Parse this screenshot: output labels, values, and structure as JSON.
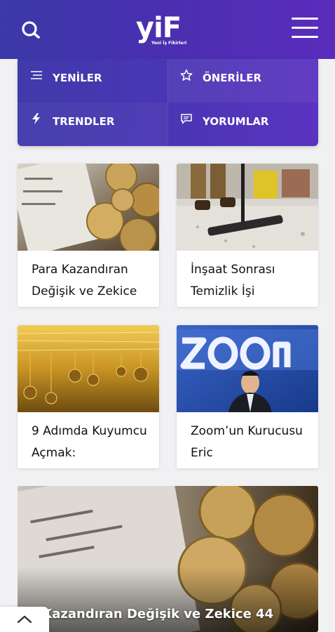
{
  "header": {
    "logo_text": "yiF",
    "logo_tagline": "Yeni İş Fikirleri",
    "search_icon": "search-icon",
    "menu_icon": "hamburger-menu-icon"
  },
  "categories": [
    {
      "label": "YENİLER",
      "icon": "list-icon"
    },
    {
      "label": "ÖNERİLER",
      "icon": "star-icon"
    },
    {
      "label": "TRENDLER",
      "icon": "lightning-icon"
    },
    {
      "label": "YORUMLAR",
      "icon": "comment-icon"
    }
  ],
  "articles": [
    {
      "title": "Para Kazandıran Değişik ve Zekice",
      "image": "coins-receipt-photo"
    },
    {
      "title": "İnşaat Sonrası Temizlik İşi",
      "image": "vacuum-cleaning-photo"
    },
    {
      "title": "9 Adımda Kuyumcu Açmak:",
      "image": "gold-jewelry-photo"
    },
    {
      "title": "Zoom’un Kurucusu Eric",
      "image": "zoom-founder-photo"
    }
  ],
  "featured": {
    "title": "ra Kazandıran Değişik ve Zekice 44",
    "image": "coins-receipt-photo"
  },
  "scroll_top_icon": "chevron-up-icon",
  "colors": {
    "header_start": "#3b39a8",
    "header_end": "#5b2cbc",
    "background": "#f1f1f3",
    "text": "#111111"
  }
}
